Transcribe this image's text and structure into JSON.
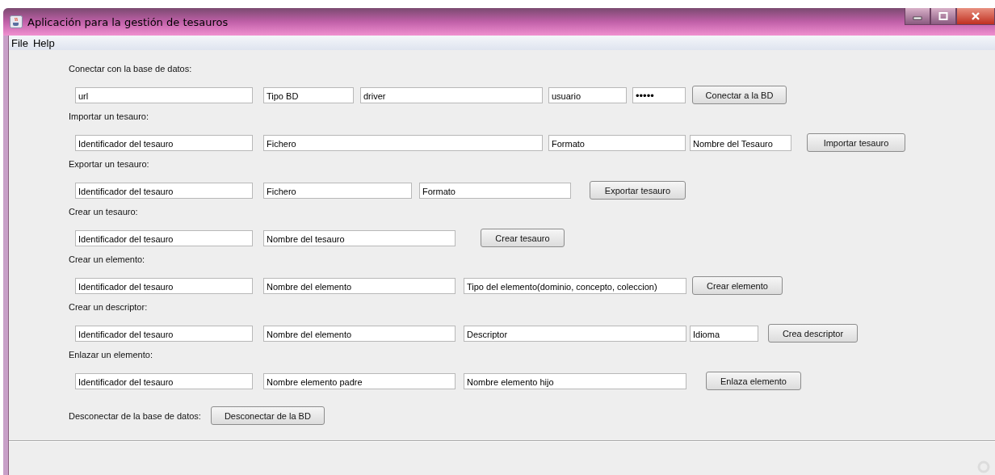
{
  "window": {
    "title": "Aplicación para la gestión de tesauros"
  },
  "menu": [
    "File",
    "Help"
  ],
  "sections": [
    {
      "label": "Conectar con la base de datos:",
      "fields": [
        {
          "kind": "text",
          "value": "url"
        },
        {
          "kind": "text",
          "value": "Tipo BD"
        },
        {
          "kind": "text",
          "value": "driver"
        },
        {
          "kind": "text",
          "value": "usuario"
        },
        {
          "kind": "password",
          "value": "•••••"
        }
      ],
      "button": "Conectar a la BD"
    },
    {
      "label": "Importar un tesauro:",
      "fields": [
        {
          "kind": "text",
          "value": "Identificador del tesauro"
        },
        {
          "kind": "text",
          "value": "Fichero"
        },
        {
          "kind": "text",
          "value": "Formato"
        },
        {
          "kind": "text",
          "value": "Nombre del Tesauro"
        }
      ],
      "button": "Importar tesauro"
    },
    {
      "label": "Exportar un tesauro:",
      "fields": [
        {
          "kind": "text",
          "value": "Identificador del tesauro"
        },
        {
          "kind": "text",
          "value": "Fichero"
        },
        {
          "kind": "text",
          "value": "Formato"
        }
      ],
      "button": "Exportar tesauro"
    },
    {
      "label": "Crear un tesauro:",
      "fields": [
        {
          "kind": "text",
          "value": "Identificador del tesauro"
        },
        {
          "kind": "text",
          "value": "Nombre del tesauro"
        }
      ],
      "button": "Crear tesauro"
    },
    {
      "label": "Crear un elemento:",
      "fields": [
        {
          "kind": "text",
          "value": "Identificador del tesauro"
        },
        {
          "kind": "text",
          "value": "Nombre del elemento"
        },
        {
          "kind": "text",
          "value": "Tipo del elemento(dominio, concepto, coleccion)"
        }
      ],
      "button": "Crear elemento"
    },
    {
      "label": "Crear un descriptor:",
      "fields": [
        {
          "kind": "text",
          "value": "Identificador del tesauro"
        },
        {
          "kind": "text",
          "value": "Nombre del elemento"
        },
        {
          "kind": "text",
          "value": "Descriptor"
        },
        {
          "kind": "text",
          "value": "Idioma"
        }
      ],
      "button": "Crea descriptor"
    },
    {
      "label": "Enlazar un elemento:",
      "fields": [
        {
          "kind": "text",
          "value": "Identificador del tesauro"
        },
        {
          "kind": "text",
          "value": "Nombre elemento padre"
        },
        {
          "kind": "text",
          "value": "Nombre elemento hijo"
        }
      ],
      "button": "Enlaza elemento"
    }
  ],
  "disconnect": {
    "label": "Desconectar de la base de datos:",
    "button": "Desconectar de la BD"
  }
}
